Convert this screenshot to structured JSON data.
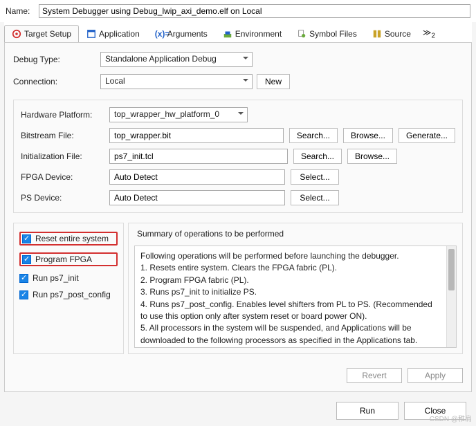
{
  "name": {
    "label": "Name:",
    "value": "System Debugger using Debug_lwip_axi_demo.elf on Local"
  },
  "tabs": {
    "items": [
      {
        "label": "Target Setup",
        "active": true
      },
      {
        "label": "Application"
      },
      {
        "label": "Arguments"
      },
      {
        "label": "Environment"
      },
      {
        "label": "Symbol Files"
      },
      {
        "label": "Source"
      }
    ],
    "more_count": "2"
  },
  "form": {
    "debug_type_label": "Debug Type:",
    "debug_type_value": "Standalone Application Debug",
    "connection_label": "Connection:",
    "connection_value": "Local",
    "new_btn": "New"
  },
  "hw": {
    "platform_label": "Hardware Platform:",
    "platform_value": "top_wrapper_hw_platform_0",
    "bitstream_label": "Bitstream File:",
    "bitstream_value": "top_wrapper.bit",
    "init_label": "Initialization File:",
    "init_value": "ps7_init.tcl",
    "fpga_label": "FPGA Device:",
    "fpga_value": "Auto Detect",
    "ps_label": "PS Device:",
    "ps_value": "Auto Detect",
    "search_btn": "Search...",
    "browse_btn": "Browse...",
    "generate_btn": "Generate...",
    "select_btn": "Select..."
  },
  "checks": {
    "reset": "Reset entire system",
    "program": "Program FPGA",
    "ps7init": "Run ps7_init",
    "ps7post": "Run ps7_post_config"
  },
  "summary": {
    "title": "Summary of operations to be performed",
    "lines": {
      "l0": "Following operations will be performed before launching the debugger.",
      "l1": "1. Resets entire system. Clears the FPGA fabric (PL).",
      "l2": "2. Program FPGA fabric (PL).",
      "l3": "3. Runs ps7_init to initialize PS.",
      "l4": "4. Runs ps7_post_config. Enables level shifters from PL to PS. (Recommended to use this option only after system reset or board power ON).",
      "l5": "5. All processors in the system will be suspended, and Applications will be downloaded to the following processors as specified in the Applications tab."
    }
  },
  "panel_buttons": {
    "revert": "Revert",
    "apply": "Apply"
  },
  "footer": {
    "run": "Run",
    "close": "Close"
  },
  "watermark": "CSDN @稚肩"
}
